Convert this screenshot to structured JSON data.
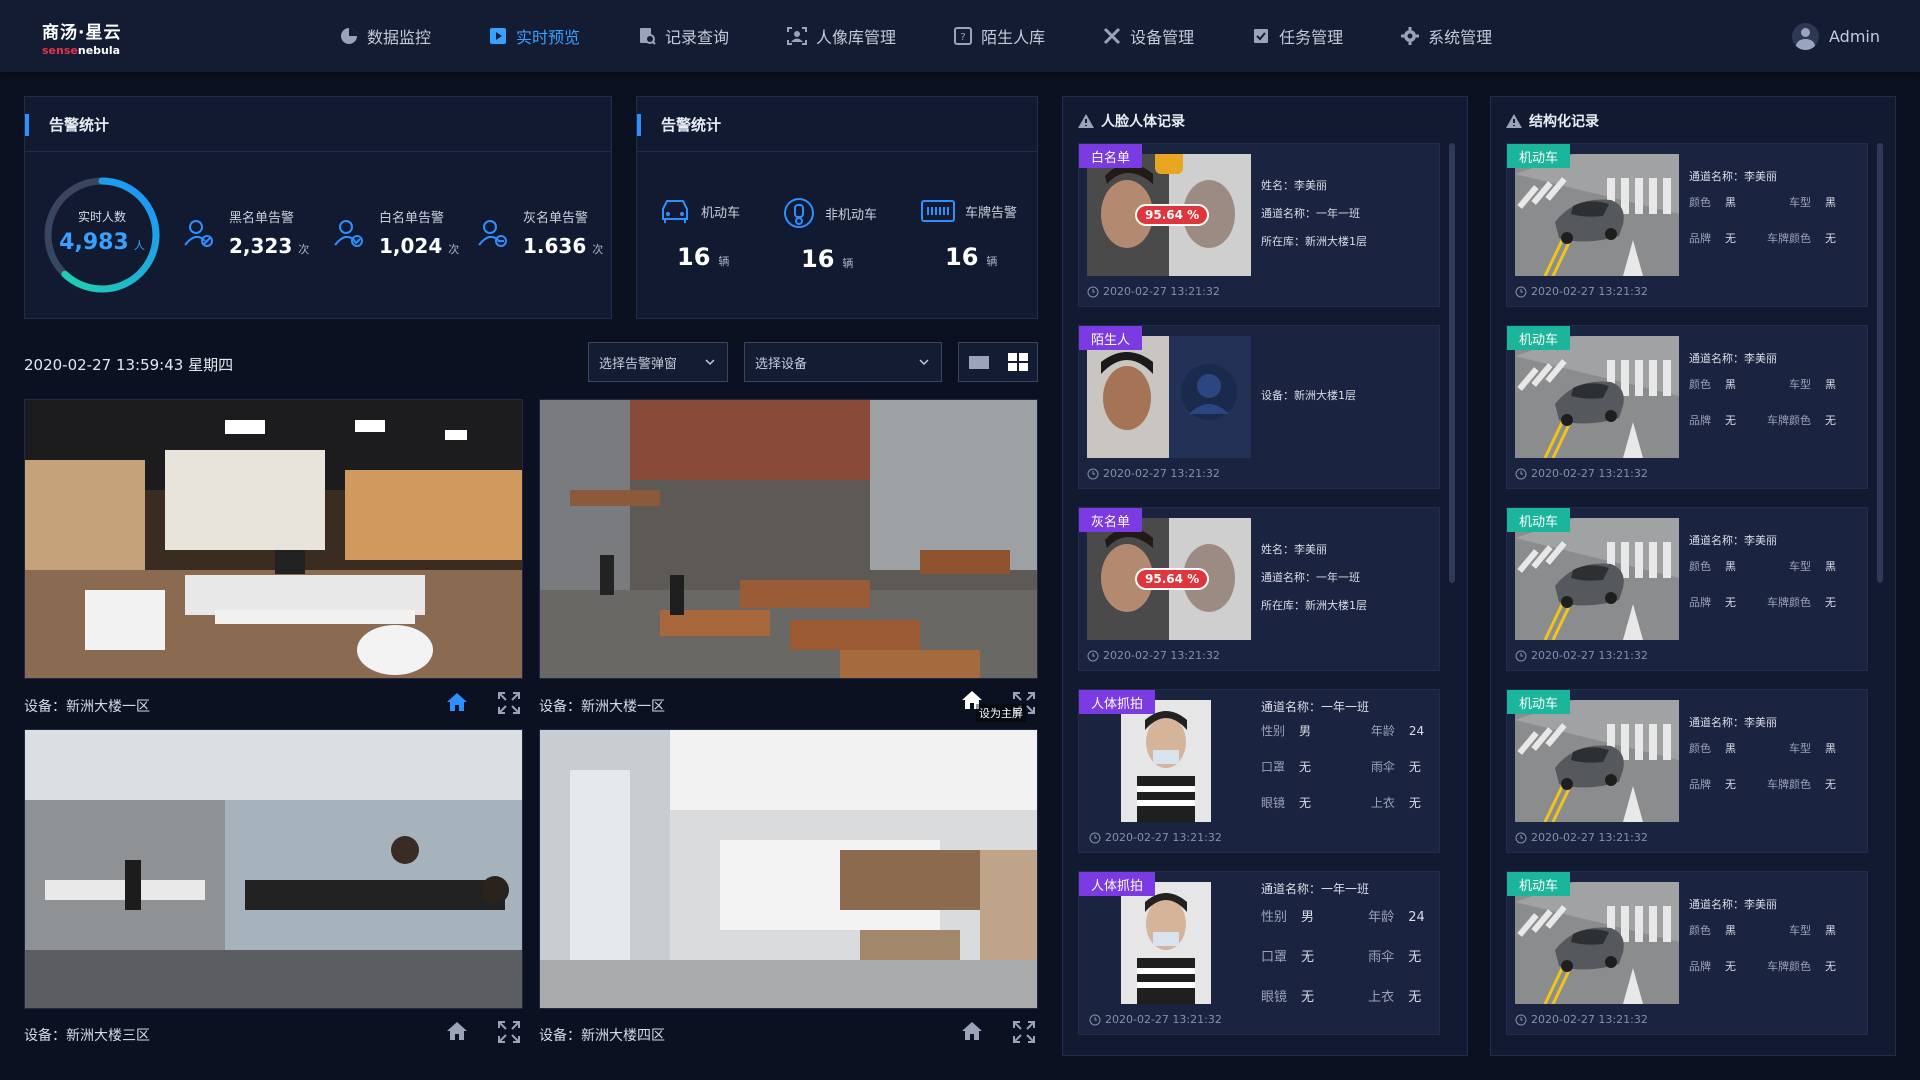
{
  "app": {
    "logo_cn": "商汤·星云",
    "logo_en_prefix": "sense",
    "logo_en_suffix": "nebula",
    "user": "Admin"
  },
  "nav": [
    {
      "label": "数据监控",
      "icon": "pie-chart-icon",
      "active": false
    },
    {
      "label": "实时预览",
      "icon": "play-icon",
      "active": true
    },
    {
      "label": "记录查询",
      "icon": "record-search-icon",
      "active": false
    },
    {
      "label": "人像库管理",
      "icon": "portrait-library-icon",
      "active": false
    },
    {
      "label": "陌生人库",
      "icon": "stranger-library-icon",
      "active": false
    },
    {
      "label": "设备管理",
      "icon": "tools-icon",
      "active": false
    },
    {
      "label": "任务管理",
      "icon": "task-check-icon",
      "active": false
    },
    {
      "label": "系统管理",
      "icon": "gear-icon",
      "active": false
    }
  ],
  "alarm1": {
    "title": "告警统计",
    "realtime": {
      "label": "实时人数",
      "value": "4,983",
      "unit": "人",
      "ring_fraction": 0.62
    },
    "items": [
      {
        "label": "黑名单告警",
        "value": "2,323",
        "unit": "次"
      },
      {
        "label": "白名单告警",
        "value": "1,024",
        "unit": "次"
      },
      {
        "label": "灰名单告警",
        "value": "1.636",
        "unit": "次"
      }
    ]
  },
  "alarm2": {
    "title": "告警统计",
    "items": [
      {
        "label": "机动车",
        "value": "16",
        "unit": "辆"
      },
      {
        "label": "非机动车",
        "value": "16",
        "unit": "辆"
      },
      {
        "label": "车牌告警",
        "value": "16",
        "unit": "辆"
      }
    ]
  },
  "toolbar": {
    "datetime": "2020-02-27 13:59:43 星期四",
    "alarm_select": "选择告警弹窗",
    "device_select": "选择设备"
  },
  "cameras": [
    {
      "device": "设备：新洲大楼一区"
    },
    {
      "device": "设备：新洲大楼一区",
      "tooltip": "设为主屏"
    },
    {
      "device": "设备：新洲大楼三区"
    },
    {
      "device": "设备：新洲大楼四区"
    }
  ],
  "face_panel": {
    "title": "人脸人体记录",
    "cards": [
      {
        "tag": "白名单",
        "score": "95.64 %",
        "lines": [
          "姓名：李美丽",
          "通道名称：一年一班",
          "所在库：新洲大楼1层"
        ],
        "time": "2020-02-27  13:21:32"
      },
      {
        "tag": "陌生人",
        "lines": [
          "设备：新洲大楼1层"
        ],
        "time": "2020-02-27  13:21:32"
      },
      {
        "tag": "灰名单",
        "score": "95.64 %",
        "lines": [
          "姓名：李美丽",
          "通道名称：一年一班",
          "所在库：新洲大楼1层"
        ],
        "time": "2020-02-27  13:21:32"
      },
      {
        "tag": "人体抓拍",
        "channel": "通道名称：一年一班",
        "attrs": [
          [
            "性别",
            "男",
            "年龄",
            "24"
          ],
          [
            "口罩",
            "无",
            "雨伞",
            "无"
          ],
          [
            "眼镜",
            "无",
            "上衣",
            "无"
          ]
        ],
        "time": "2020-02-27  13:21:32"
      },
      {
        "tag": "人体抓拍",
        "channel": "通道名称：一年一班",
        "attrs": [
          [
            "性别",
            "男",
            "年龄",
            "24"
          ],
          [
            "口罩",
            "无",
            "雨伞",
            "无"
          ],
          [
            "眼镜",
            "无",
            "上衣",
            "无"
          ]
        ],
        "time": "2020-02-27  13:21:32"
      }
    ]
  },
  "struct_panel": {
    "title": "结构化记录",
    "cards": [
      {
        "tag": "机动车",
        "channel": "通道名称：李美丽",
        "attrs": [
          [
            "颜色",
            "黑",
            "车型",
            "黑"
          ],
          [
            "品牌",
            "无",
            "车牌颜色",
            "无"
          ]
        ],
        "time": "2020-02-27  13:21:32"
      },
      {
        "tag": "机动车",
        "channel": "通道名称：李美丽",
        "attrs": [
          [
            "颜色",
            "黑",
            "车型",
            "黑"
          ],
          [
            "品牌",
            "无",
            "车牌颜色",
            "无"
          ]
        ],
        "time": "2020-02-27  13:21:32"
      },
      {
        "tag": "机动车",
        "channel": "通道名称：李美丽",
        "attrs": [
          [
            "颜色",
            "黑",
            "车型",
            "黑"
          ],
          [
            "品牌",
            "无",
            "车牌颜色",
            "无"
          ]
        ],
        "time": "2020-02-27  13:21:32"
      },
      {
        "tag": "机动车",
        "channel": "通道名称：李美丽",
        "attrs": [
          [
            "颜色",
            "黑",
            "车型",
            "黑"
          ],
          [
            "品牌",
            "无",
            "车牌颜色",
            "无"
          ]
        ],
        "time": "2020-02-27  13:21:32"
      },
      {
        "tag": "机动车",
        "channel": "通道名称：李美丽",
        "attrs": [
          [
            "颜色",
            "黑",
            "车型",
            "黑"
          ],
          [
            "品牌",
            "无",
            "车牌颜色",
            "无"
          ]
        ],
        "time": "2020-02-27  13:21:32"
      }
    ]
  },
  "colors": {
    "accent": "#3aa0ff",
    "whitelist": "#7b3be2",
    "vehicle": "#1bb59b",
    "score": "#e0353d"
  }
}
